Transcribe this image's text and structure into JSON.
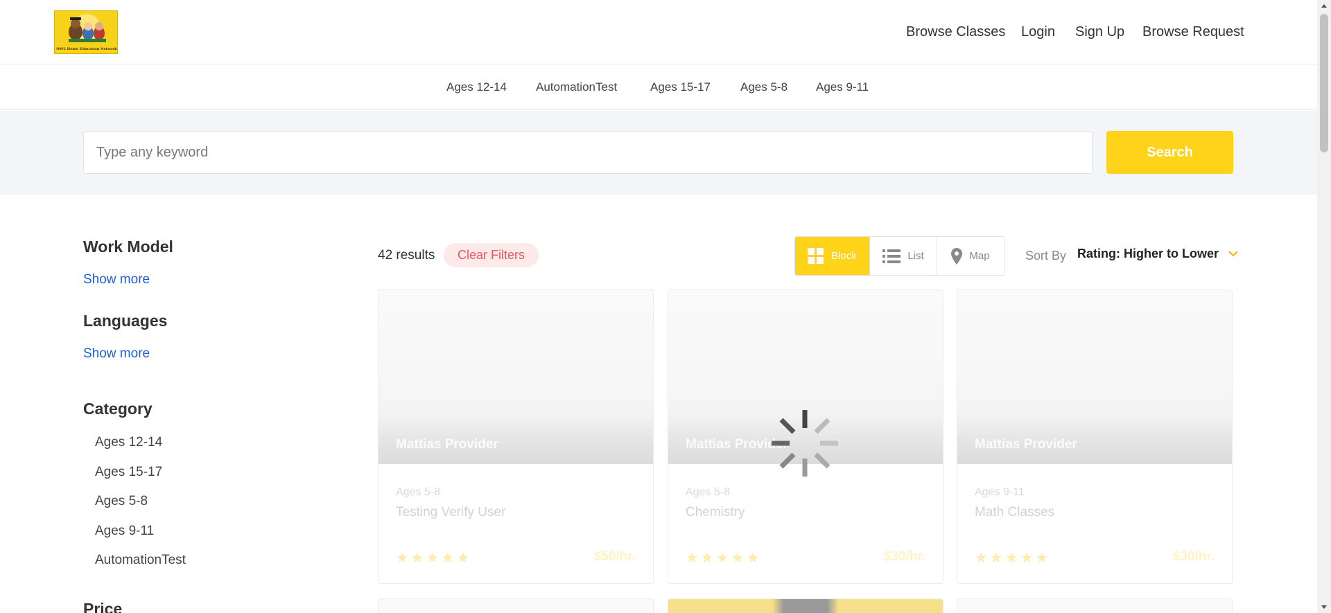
{
  "header": {
    "logo_text": "OWL Home Education Network",
    "nav": [
      "Browse Classes",
      "Login",
      "Sign Up",
      "Browse Request"
    ]
  },
  "category_bar": [
    "Ages 12-14",
    "AutomationTest",
    "Ages 15-17",
    "Ages 5-8",
    "Ages 9-11"
  ],
  "search": {
    "placeholder": "Type any keyword",
    "value": "",
    "button_label": "Search"
  },
  "sidebar": {
    "work_model": {
      "title": "Work Model",
      "show_more": "Show more"
    },
    "languages": {
      "title": "Languages",
      "show_more": "Show more"
    },
    "category": {
      "title": "Category",
      "items": [
        "Ages 12-14",
        "Ages 15-17",
        "Ages 5-8",
        "Ages 9-11",
        "AutomationTest"
      ]
    },
    "price": {
      "title": "Price"
    }
  },
  "results": {
    "count_text": "42 results",
    "clear_filters": "Clear Filters",
    "views": [
      {
        "label": "Block",
        "icon": "grid-icon",
        "active": true
      },
      {
        "label": "List",
        "icon": "list-icon",
        "active": false
      },
      {
        "label": "Map",
        "icon": "map-pin-icon",
        "active": false
      }
    ],
    "sort_label": "Sort By",
    "sort_value": "Rating: Higher to Lower"
  },
  "cards": [
    {
      "provider": "Mattias Provider",
      "age": "Ages 5-8",
      "title": "Testing Verify User",
      "price": "$50/hr.",
      "rating": 5
    },
    {
      "provider": "Mattias Provider",
      "age": "Ages 5-8",
      "title": "Chemistry",
      "price": "$30/hr.",
      "rating": 5
    },
    {
      "provider": "Mattias Provider",
      "age": "Ages 9-11",
      "title": "Math Classes",
      "price": "$30/hr.",
      "rating": 5
    }
  ],
  "colors": {
    "accent": "#ffd31a",
    "link": "#1e5fd0",
    "clear_filters_bg": "#fde8ea",
    "clear_filters_text": "#e35a5a"
  },
  "loading": true
}
